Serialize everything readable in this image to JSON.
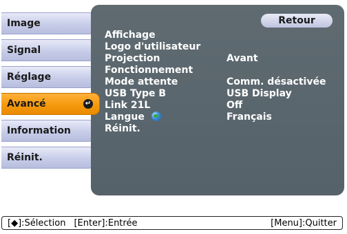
{
  "sidebar": {
    "items": [
      {
        "label": "Image",
        "active": false
      },
      {
        "label": "Signal",
        "active": false
      },
      {
        "label": "Réglage",
        "active": false
      },
      {
        "label": "Avancé",
        "active": true
      },
      {
        "label": "Information",
        "active": false
      },
      {
        "label": "Réinit.",
        "active": false
      }
    ],
    "enter_icon": "enter-return-icon"
  },
  "panel": {
    "back_label": "Retour",
    "rows": [
      {
        "label": "Affichage",
        "value": ""
      },
      {
        "label": "Logo d'utilisateur",
        "value": ""
      },
      {
        "label": "Projection",
        "value": "Avant"
      },
      {
        "label": "Fonctionnement",
        "value": ""
      },
      {
        "label": "Mode attente",
        "value": "Comm. désactivée"
      },
      {
        "label": "USB Type B",
        "value": "USB Display"
      },
      {
        "label": "Link 21L",
        "value": "Off"
      },
      {
        "label": "Langue",
        "value": "Français",
        "icon": "globe-icon"
      },
      {
        "label": "Réinit.",
        "value": ""
      }
    ]
  },
  "statusbar": {
    "select_hint": "[◆]:Sélection",
    "enter_hint": "[Enter]:Entrée",
    "quit_hint": "[Menu]:Quitter"
  },
  "colors": {
    "active_tab": "#f59a0e",
    "tab": "#c7cde8",
    "panel": "#5f6b71"
  }
}
